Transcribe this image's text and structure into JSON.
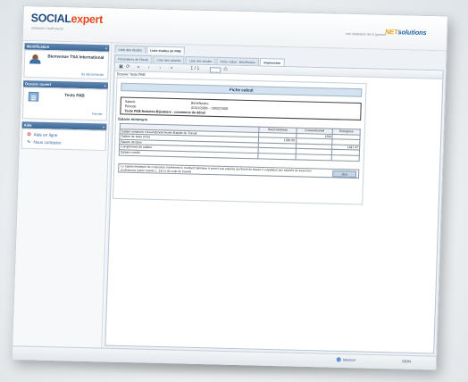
{
  "brand": {
    "name_part1": "SOCIAL",
    "name_part2": "expert",
    "tagline": "solutions / audit social",
    "vendor_note": "une réalisation de la gamme",
    "vendor_logo_part1": "NET",
    "vendor_logo_part2": "solutions"
  },
  "sidebar": {
    "identification": {
      "title": "Identification",
      "user_name": "Bienvenue TSA International",
      "logout_link": "Se déconnecter"
    },
    "dossier": {
      "title": "Dossier ouvert",
      "name": "Tests PAB",
      "open_link": "Fermer"
    },
    "aide": {
      "title": "Aide",
      "items": [
        {
          "label": "Aide en ligne",
          "icon": "help-icon"
        },
        {
          "label": "Nous contacter",
          "icon": "contact-icon"
        }
      ]
    }
  },
  "tabs_primary": [
    {
      "label": "Liste des études",
      "active": false
    },
    {
      "label": "Liste études de PAB",
      "active": true
    }
  ],
  "tabs_secondary": [
    {
      "label": "Paramètres de l'étude",
      "active": false
    },
    {
      "label": "Liste des salariés",
      "active": false
    },
    {
      "label": "Liste des études",
      "active": false
    },
    {
      "label": "Fiche calcul : Bénéficiaire",
      "active": false
    },
    {
      "label": "Impression",
      "active": true
    }
  ],
  "toolbar": {
    "page_info": "1 / 1"
  },
  "document": {
    "subtitle": "Dossier Tests PAB",
    "sheet_title": "Fiche calcul",
    "info_rows": [
      {
        "label": "Salarié",
        "value": "Bénéficiaire"
      },
      {
        "label": "Période",
        "value": "01/01/2008 – 29/02/2008"
      },
      {
        "label": "Texte PAB-Notaires-Bijoutiers : commerce de détail",
        "value": ""
      }
    ],
    "section_title": "Salaire minimum",
    "table": {
      "headers": [
        "",
        "Seuil minimum",
        "Conventionnel",
        "Entreprise"
      ],
      "rows": [
        [
          "Salaire minimum conventionnel Accès Rapide du Travail",
          "",
          "1200",
          ""
        ],
        [
          "Salaire de base (min)",
          "1280.00",
          "",
          ""
        ],
        [
          "Salaire de base",
          "",
          "",
          "1647.47"
        ],
        [
          "Complément de salaire",
          "",
          "",
          ""
        ],
        [
          "Salaire corrélé",
          "",
          "",
          ""
        ]
      ]
    },
    "conclusion": {
      "text": "Le salaire minimum de croissance représente le montant minimum à verser aux salariés qui fixent du travail. Il s'applique aux salariés de toutes les professions (selon l'article L. 141-2 du code du travail)",
      "badge": "OUI"
    }
  },
  "statusbar": {
    "zone": "Internet",
    "zoom": "100%"
  }
}
